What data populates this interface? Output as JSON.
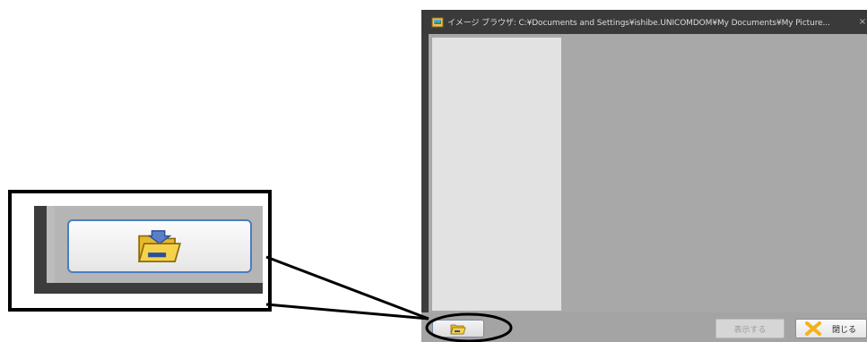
{
  "window": {
    "title": "イメージ ブラウザ: C:¥Documents and Settings¥ishibe.UNICOMDOM¥My Documents¥My Picture...",
    "close_glyph": "×"
  },
  "buttons": {
    "show_label": "表示する",
    "close_label": "閉じる"
  },
  "icons": {
    "title": "image-browser-icon",
    "folder_open": "folder-open-icon",
    "close": "close-x-icon"
  },
  "colors": {
    "titlebar": "#3a3a3a",
    "client": "#a8a8a8",
    "tree_pane": "#e2e2e2",
    "highlight_border": "#4a7dc2",
    "close_x": "#f2b21a"
  }
}
